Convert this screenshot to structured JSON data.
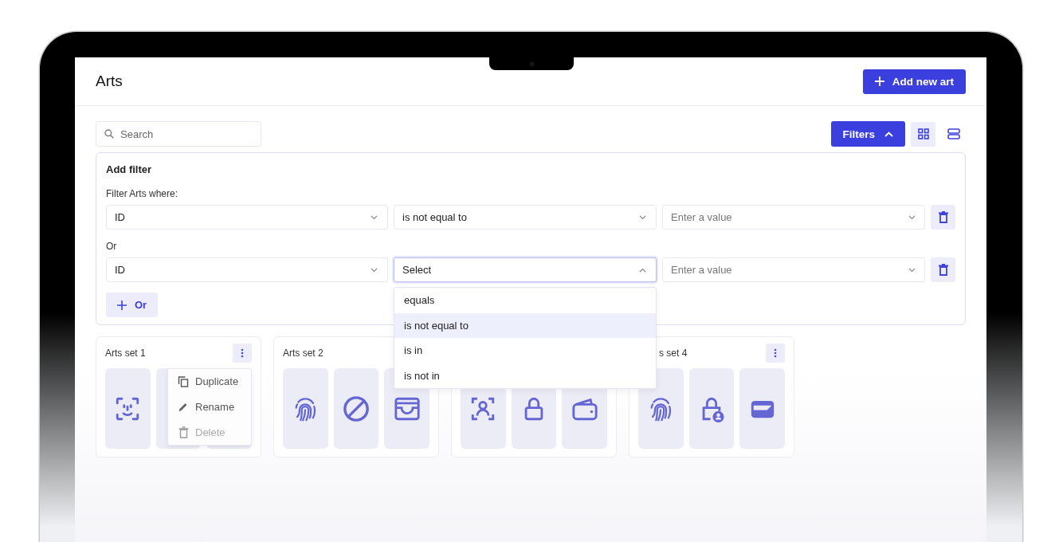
{
  "page": {
    "title": "Arts",
    "add_button": "Add new art"
  },
  "search": {
    "placeholder": "Search"
  },
  "filters_button": {
    "label": "Filters",
    "expanded": true
  },
  "view_toggles": [
    {
      "kind": "grid",
      "selected": true
    },
    {
      "kind": "list",
      "selected": false
    }
  ],
  "filter_panel": {
    "title": "Add filter",
    "rows": [
      {
        "label": "Filter Arts where:",
        "field": "ID",
        "operator": "is not equal to",
        "value_placeholder": "Enter a value",
        "open": false
      },
      {
        "label": "Or",
        "field": "ID",
        "operator": "Select",
        "value_placeholder": "Enter a value",
        "open": true
      }
    ],
    "add_button": "Or"
  },
  "operator_menu": [
    {
      "label": "equals",
      "selected": false
    },
    {
      "label": "is not equal to",
      "selected": true
    },
    {
      "label": "is in",
      "selected": false
    },
    {
      "label": "is not in",
      "selected": false
    }
  ],
  "sets": [
    {
      "kind": "art-set",
      "title": "Arts set 1",
      "menu": [
        {
          "label": "Duplicate",
          "disabled": false
        },
        {
          "label": "Rename",
          "disabled": false
        },
        {
          "label": "Delete",
          "disabled": true
        }
      ]
    },
    {
      "kind": "art-set",
      "title": "Arts set 2"
    },
    {
      "kind": "art-set"
    },
    {
      "kind": "art-set",
      "title": "s set 4"
    }
  ]
}
